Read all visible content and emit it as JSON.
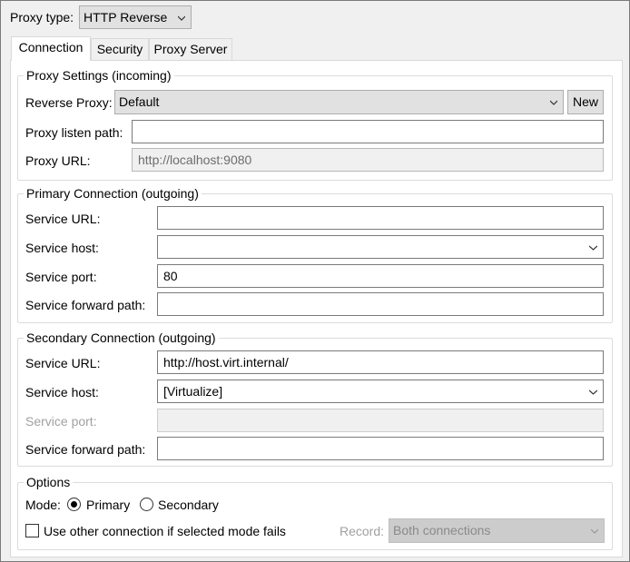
{
  "header": {
    "proxy_type_label": "Proxy type:",
    "proxy_type_value": "HTTP Reverse"
  },
  "tabs": [
    {
      "label": "Connection",
      "active": true
    },
    {
      "label": "Security",
      "active": false
    },
    {
      "label": "Proxy Server",
      "active": false
    }
  ],
  "proxy_settings": {
    "title": "Proxy Settings (incoming)",
    "reverse_proxy_label": "Reverse Proxy:",
    "reverse_proxy_value": "Default",
    "new_button": "New",
    "listen_path_label": "Proxy listen path:",
    "listen_path_value": "",
    "proxy_url_label": "Proxy URL:",
    "proxy_url_value": "http://localhost:9080"
  },
  "primary": {
    "title": "Primary Connection (outgoing)",
    "service_url_label": "Service URL:",
    "service_url_value": "",
    "service_host_label": "Service host:",
    "service_host_value": "",
    "service_port_label": "Service port:",
    "service_port_value": "80",
    "forward_path_label": "Service forward path:",
    "forward_path_value": ""
  },
  "secondary": {
    "title": "Secondary Connection (outgoing)",
    "service_url_label": "Service URL:",
    "service_url_value": "http://host.virt.internal/",
    "service_host_label": "Service host:",
    "service_host_value": "[Virtualize]",
    "service_port_label": "Service port:",
    "service_port_value": "",
    "forward_path_label": "Service forward path:",
    "forward_path_value": ""
  },
  "options": {
    "title": "Options",
    "mode_label": "Mode:",
    "mode_primary": "Primary",
    "mode_secondary": "Secondary",
    "mode_selected": "Primary",
    "fallback_label": "Use other connection if selected mode fails",
    "fallback_checked": false,
    "record_label": "Record:",
    "record_value": "Both connections"
  }
}
